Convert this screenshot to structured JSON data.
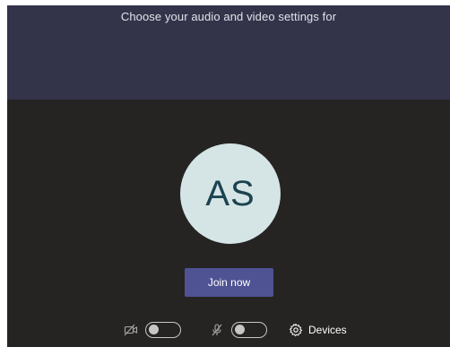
{
  "header": {
    "title": "Choose your audio and video settings for"
  },
  "preview": {
    "avatar_initials": "AS"
  },
  "actions": {
    "join_label": "Join now"
  },
  "controls": {
    "camera_icon": "camera-off-icon",
    "camera_toggle_on": false,
    "mic_icon": "mic-off-icon",
    "mic_toggle_on": false,
    "devices_icon": "gear-icon",
    "devices_label": "Devices"
  },
  "colors": {
    "header_bg": "#33344a",
    "preview_bg": "#252423",
    "avatar_bg": "#d5e5e5",
    "avatar_text": "#1c4350",
    "join_button": "#4f5394"
  }
}
